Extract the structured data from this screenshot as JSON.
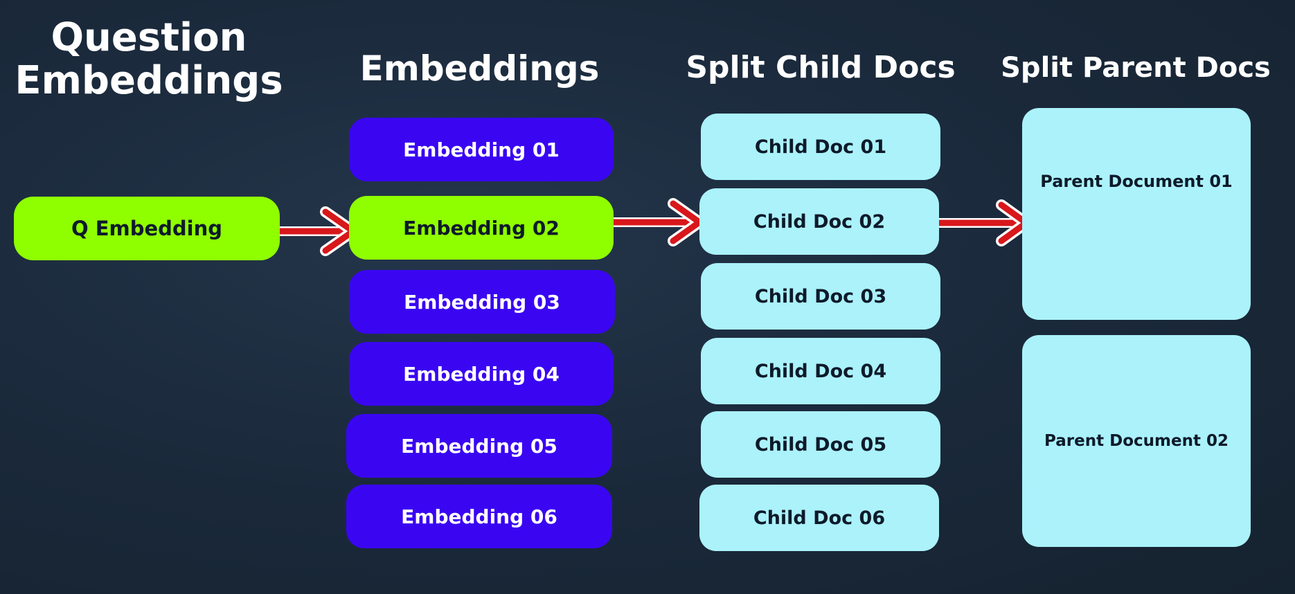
{
  "columns": {
    "question_title": [
      "Question",
      "Embeddings"
    ],
    "embeddings_title": "Embeddings",
    "child_title": "Split Child Docs",
    "parent_title": "Split Parent Docs"
  },
  "question": {
    "label": "Q Embedding"
  },
  "embeddings": [
    "Embedding 01",
    "Embedding 02",
    "Embedding 03",
    "Embedding 04",
    "Embedding 05",
    "Embedding 06"
  ],
  "child_docs": [
    "Child Doc 01",
    "Child Doc 02",
    "Child Doc 03",
    "Child Doc 04",
    "Child Doc 05",
    "Child Doc 06"
  ],
  "parent_docs": [
    "Parent Document 01",
    "Parent Document 02"
  ],
  "highlight": {
    "embedding": "Embedding 02",
    "child_doc": "Child Doc 02",
    "parent_doc": "Parent Document 01"
  },
  "colors": {
    "embedding_box": "#3a06f2",
    "highlight_box": "#8fff00",
    "doc_box": "#abf2fb",
    "arrow": "#d8171b",
    "background": "#1b2a3c"
  }
}
